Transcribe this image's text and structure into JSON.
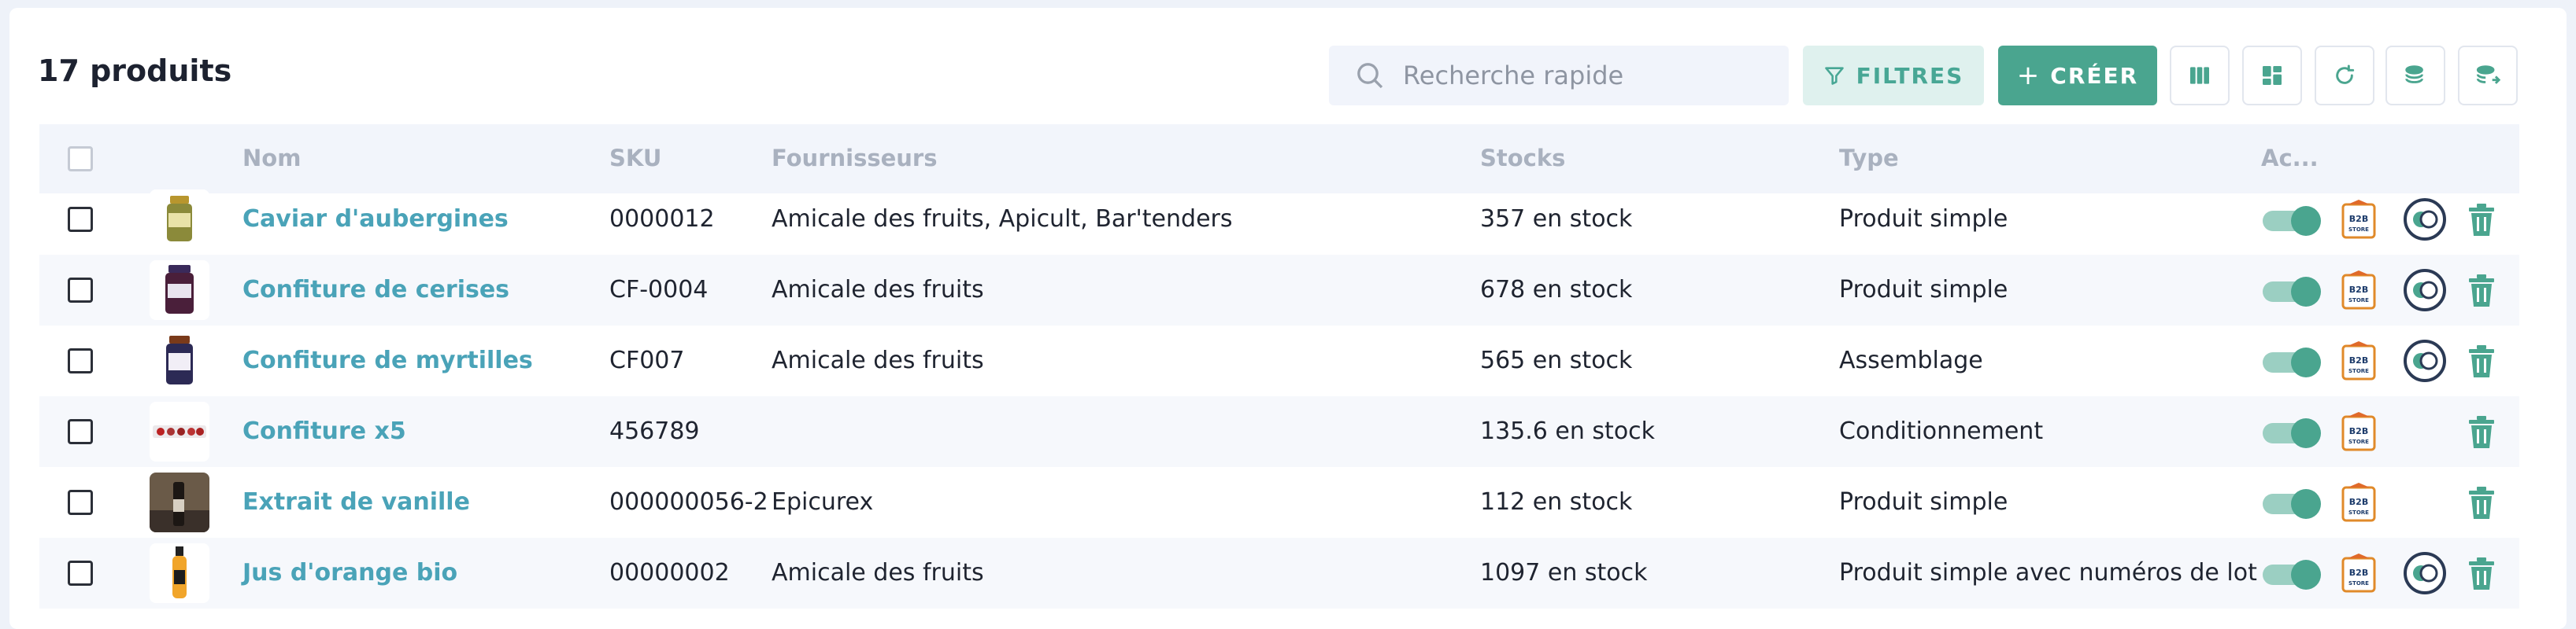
{
  "header": {
    "title": "17 produits",
    "search_placeholder": "Recherche rapide",
    "filters_label": "FILTRES",
    "create_label": "CRÉER"
  },
  "toolbar": {
    "icons": [
      "columns-icon",
      "layout-icon",
      "refresh-icon",
      "stack-import-icon",
      "stack-export-icon"
    ]
  },
  "table": {
    "columns": [
      "Nom",
      "SKU",
      "Fournisseurs",
      "Stocks",
      "Type",
      "Ac..."
    ],
    "rows": [
      {
        "name": "Caviar d'aubergines",
        "sku": "0000012",
        "suppliers": "Amicale des fruits, Apicult, Bar'tenders",
        "stock": "357 en stock",
        "type": "Produit simple",
        "active": true,
        "b2b_label": "B2B STORE",
        "integration": true
      },
      {
        "name": "Confiture de cerises",
        "sku": "CF-0004",
        "suppliers": "Amicale des fruits",
        "stock": "678 en stock",
        "type": "Produit simple",
        "active": true,
        "b2b_label": "B2B STORE",
        "integration": true
      },
      {
        "name": "Confiture de myrtilles",
        "sku": "CF007",
        "suppliers": "Amicale des fruits",
        "stock": "565 en stock",
        "type": "Assemblage",
        "active": true,
        "b2b_label": "B2B STORE",
        "integration": true
      },
      {
        "name": "Confiture x5",
        "sku": "456789",
        "suppliers": "",
        "stock": "135.6 en stock",
        "type": "Conditionnement",
        "active": true,
        "b2b_label": "B2B STORE",
        "integration": false
      },
      {
        "name": "Extrait de vanille",
        "sku": "000000056-2",
        "suppliers": "Epicurex",
        "stock": "112 en stock",
        "type": "Produit simple",
        "active": true,
        "b2b_label": "B2B STORE",
        "integration": false
      },
      {
        "name": "Jus d'orange bio",
        "sku": "00000002",
        "suppliers": "Amicale des fruits",
        "stock": "1097 en stock",
        "type": "Produit simple avec numéros de lot",
        "active": true,
        "b2b_label": "B2B STORE",
        "integration": true
      }
    ]
  },
  "colors": {
    "accent": "#4aa58f",
    "accent_light": "#dff1ee",
    "link": "#4aa3b8",
    "header_text": "#a9b1bf",
    "row_alt": "#f6f8fc"
  }
}
